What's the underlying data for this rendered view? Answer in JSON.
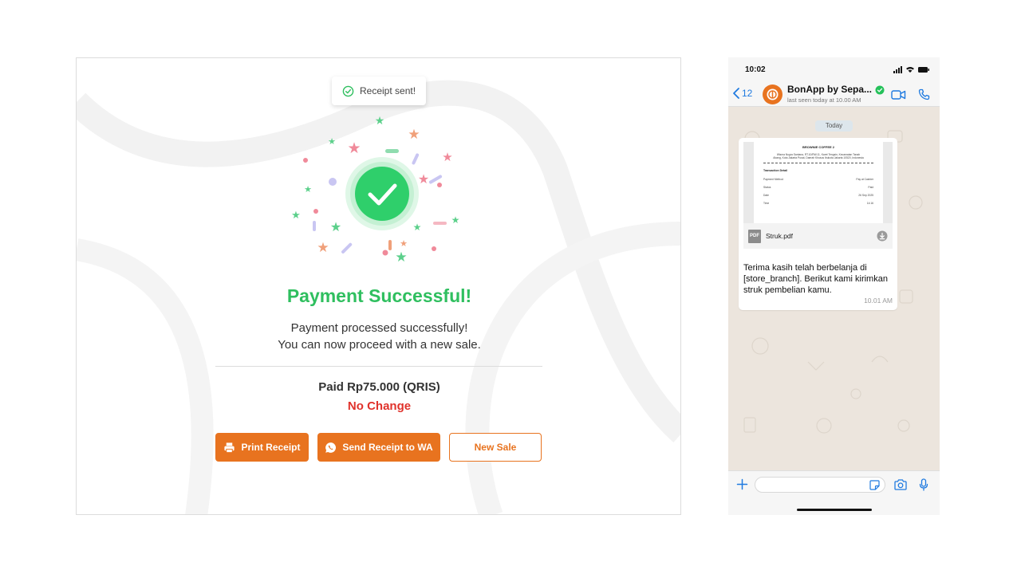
{
  "pos": {
    "toast": "Receipt sent!",
    "title": "Payment Successful!",
    "message_line1": "Payment processed successfully!",
    "message_line2": "You can now proceed with a new sale.",
    "paid": "Paid Rp75.000 (QRIS)",
    "change": "No Change",
    "buttons": {
      "print": "Print Receipt",
      "send_wa": "Send Receipt to WA",
      "new_sale": "New Sale"
    },
    "colors": {
      "success": "#2fbf5f",
      "accent": "#e8731f",
      "danger": "#e0322b"
    }
  },
  "phone": {
    "time": "10:02",
    "back_count": "12",
    "contact_name": "BonApp by Sepa...",
    "last_seen": "last seen today at 10.00 AM",
    "date_chip": "Today",
    "receipt": {
      "store": "BROWNIE COFFEE 2",
      "address": "Wisma Nugra Santana, RT.10/RW.11, Karet Tengsin, Kecamatan Tanah Abang, Kota Jakarta Pusat, Daerah Khusus Ibukota Jakarta 10520, Indonesia",
      "section": "Transaction Detail",
      "rows": [
        {
          "label": "Payment Method",
          "value": "Pay at Cashier"
        },
        {
          "label": "Status",
          "value": "Paid"
        },
        {
          "label": "Date",
          "value": "26 Sep 2025"
        },
        {
          "label": "Time",
          "value": "14:16"
        }
      ]
    },
    "file_name": "Struk.pdf",
    "file_type": "PDF",
    "message_text": "Terima kasih telah berbelanja di [store_branch]. Berikut kami kirimkan struk pembelian kamu.",
    "message_time": "10.01 AM"
  }
}
